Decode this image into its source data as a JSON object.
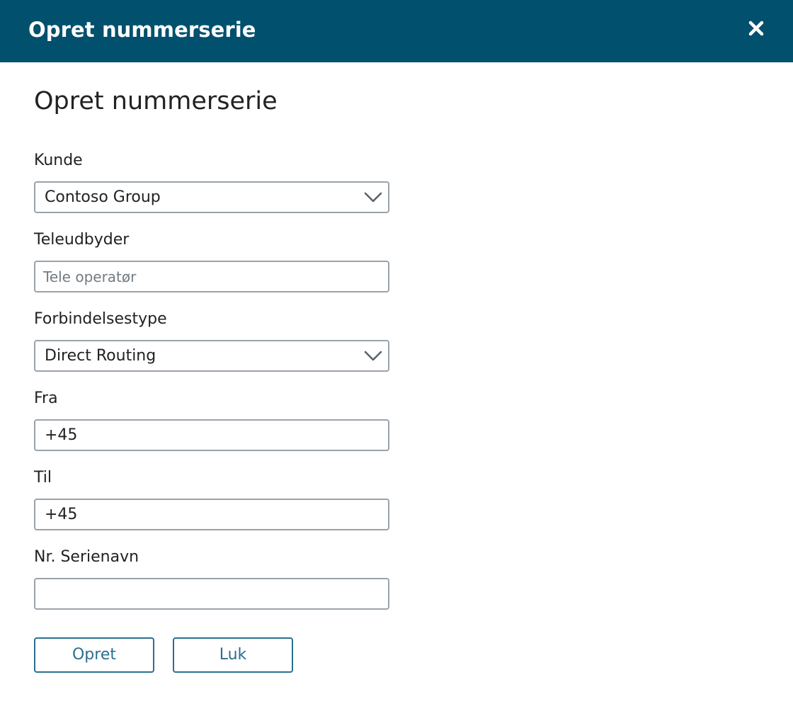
{
  "dialog": {
    "title": "Opret nummerserie",
    "close_icon": "close-icon",
    "header_color": "#00506e"
  },
  "form": {
    "title": "Opret nummerserie",
    "kunde": {
      "label": "Kunde",
      "value": "Contoso Group",
      "icon": "chevron-down-icon"
    },
    "teleudbyder": {
      "label": "Teleudbyder",
      "value": "",
      "placeholder": "Tele operatør"
    },
    "forbindelsestype": {
      "label": "Forbindelsestype",
      "value": "Direct Routing",
      "icon": "chevron-down-icon"
    },
    "fra": {
      "label": "Fra",
      "value": "+45"
    },
    "til": {
      "label": "Til",
      "value": "+45"
    },
    "serienavn": {
      "label": "Nr. Serienavn",
      "value": ""
    }
  },
  "buttons": {
    "create_label": "Opret",
    "close_label": "Luk",
    "accent": "#2b6f8f"
  }
}
